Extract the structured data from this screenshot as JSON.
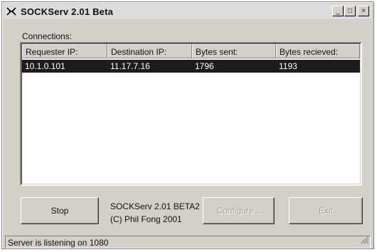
{
  "window": {
    "title": "SOCKServ 2.01 Beta"
  },
  "title_buttons": {
    "minimize": "_",
    "maximize": "□",
    "close": "×"
  },
  "connections": {
    "label": "Connections:",
    "columns": [
      "Requester IP:",
      "Destination IP:",
      "Bytes sent:",
      "Bytes recieved:"
    ],
    "rows": [
      [
        "10.1.0.101",
        "11.17.7.16",
        "1796",
        "1193"
      ]
    ]
  },
  "buttons": {
    "stop": "Stop",
    "configure": "Configure...",
    "exit": "Exit"
  },
  "info": {
    "line1": "SOCKServ 2.01 BETA2",
    "line2": "(C) Phil Fong 2001"
  },
  "status": {
    "text": "Server is listening on 1080"
  }
}
